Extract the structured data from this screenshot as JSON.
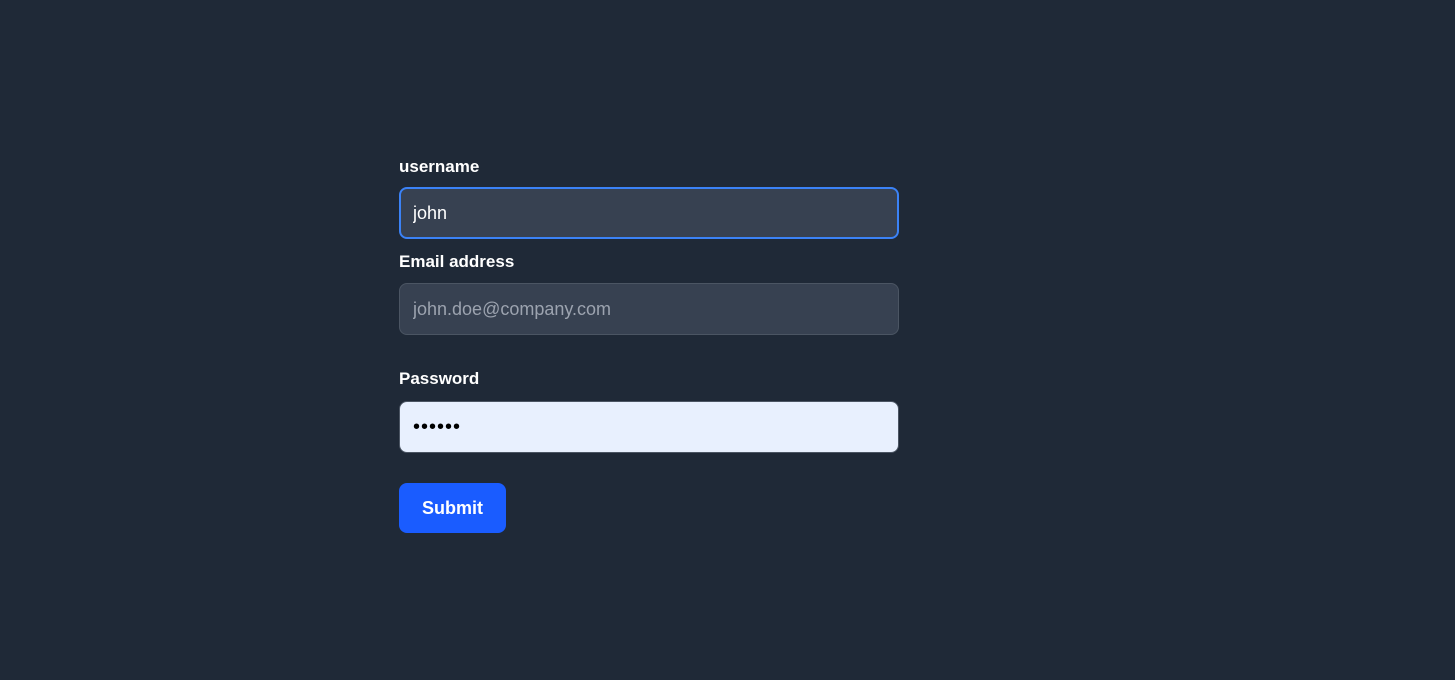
{
  "form": {
    "username": {
      "label": "username",
      "value": "john",
      "focused": true
    },
    "email": {
      "label": "Email address",
      "placeholder": "john.doe@company.com",
      "value": ""
    },
    "password": {
      "label": "Password",
      "value": "••••••"
    },
    "submit_label": "Submit"
  },
  "colors": {
    "background": "#1f2937",
    "input_dark": "#374151",
    "input_autofill": "#e8f0fe",
    "focus_ring": "#3b82f6",
    "button": "#1a5cff"
  }
}
